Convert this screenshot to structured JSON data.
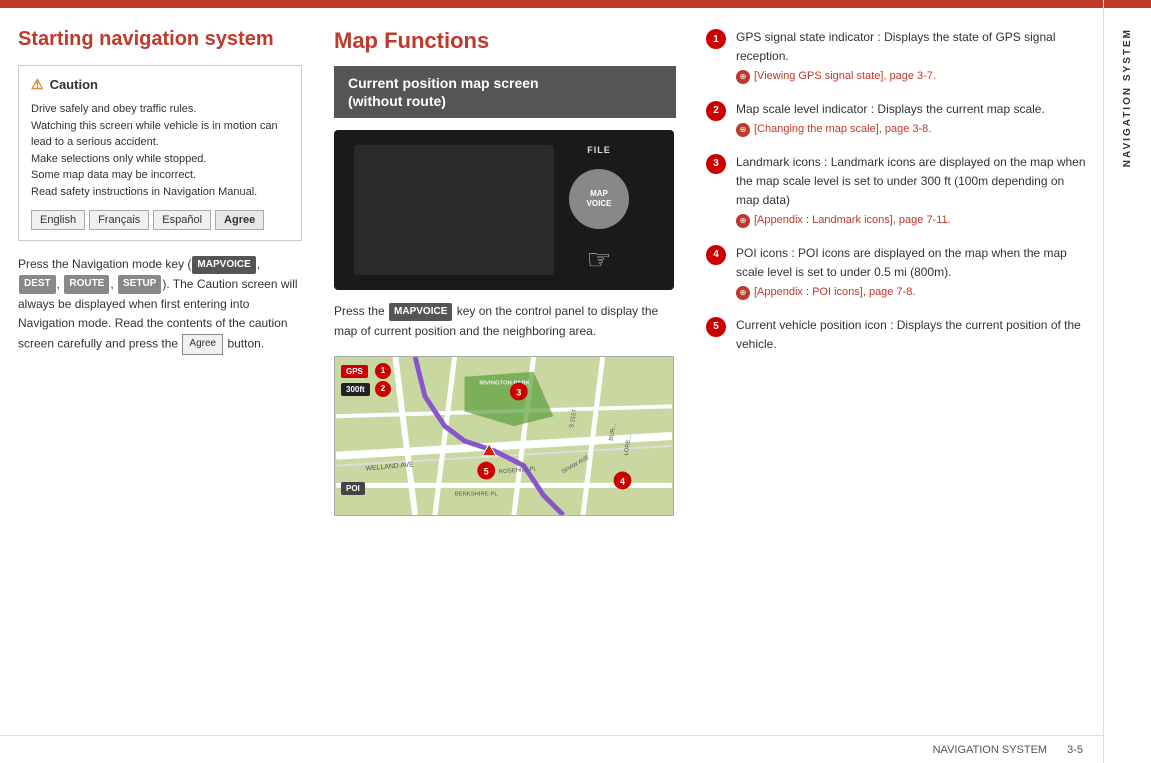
{
  "top_bar": {},
  "left_column": {
    "title": "Starting navigation system",
    "caution": {
      "header": "Caution",
      "body": "Drive safely and obey traffic rules.\nWatching this screen while vehicle is in motion can lead to a serious accident.\nMake selections only while stopped.\nSome map data may be incorrect.\nRead safety instructions in Navigation Manual.",
      "buttons": [
        "English",
        "Français",
        "Español",
        "Agree"
      ]
    },
    "body_text_parts": [
      "Press the Navigation mode key (",
      "MAPVOICE",
      ", ",
      "DEST",
      ", ",
      "ROUTE",
      ", ",
      "SETUP",
      "). The Caution screen will always be displayed when first entering into Navigation mode. Read the contents of the caution screen carefully and press the ",
      "Agree",
      " button."
    ]
  },
  "middle_column": {
    "title": "Map Functions",
    "section_header": "Current position map screen\n(without route)",
    "device_labels": {
      "file": "FILE",
      "map_voice": "MAP\nVOICE"
    },
    "body_text": "Press the MAPVOICE key on the control panel to display the map of current position and the neighboring area.",
    "mapvoice_badge": "MAPVOICE"
  },
  "right_column": {
    "items": [
      {
        "num": "1",
        "text": "GPS signal state indicator : Displays the state of GPS signal reception.",
        "ref": "[Viewing GPS signal state], page 3-7."
      },
      {
        "num": "2",
        "text": "Map scale level indicator : Displays the current map scale.",
        "ref": "[Changing the map scale], page 3-8."
      },
      {
        "num": "3",
        "text": "Landmark icons : Landmark icons are displayed on the map when the map scale level is set to under 300 ft (100m depending on map data)",
        "ref": "[Appendix : Landmark icons], page 7-11."
      },
      {
        "num": "4",
        "text": "POI icons : POI icons are displayed on the map when the map scale level is set to under 0.5 mi (800m).",
        "ref": "[Appendix : POI icons], page 7-8."
      },
      {
        "num": "5",
        "text": "Current vehicle position icon : Displays the current position of the vehicle.",
        "ref": ""
      }
    ]
  },
  "sidebar": {
    "label": "NAVIGATION SYSTEM"
  },
  "footer": {
    "section": "NAVIGATION SYSTEM",
    "page": "3-5"
  }
}
